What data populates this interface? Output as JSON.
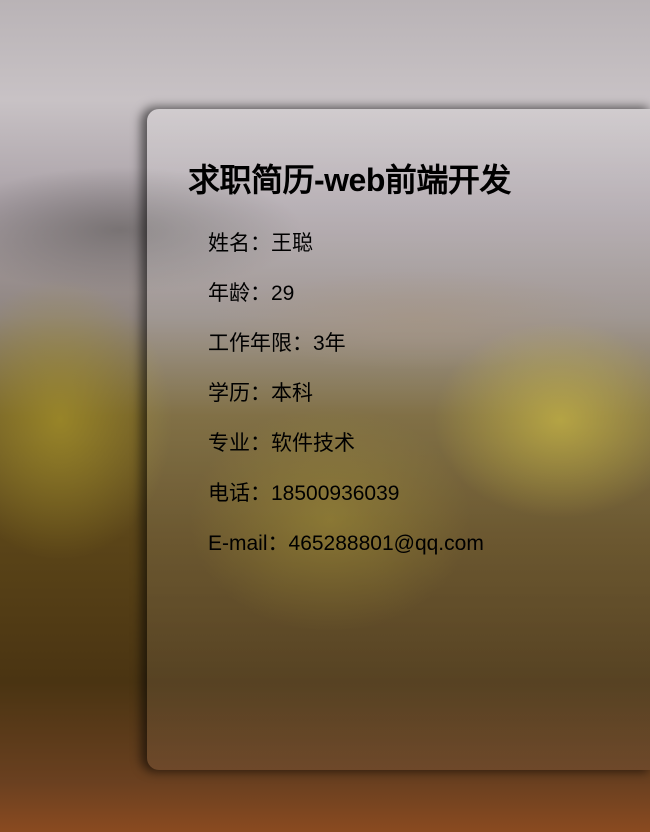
{
  "title": "求职简历-web前端开发",
  "items": [
    {
      "label": "姓名",
      "value": "王聪"
    },
    {
      "label": "年龄",
      "value": "29"
    },
    {
      "label": "工作年限",
      "value": "3年"
    },
    {
      "label": "学历",
      "value": "本科"
    },
    {
      "label": "专业",
      "value": "软件技术"
    },
    {
      "label": "电话",
      "value": "18500936039"
    },
    {
      "label": "E-mail",
      "value": "465288801@qq.com"
    }
  ],
  "separator": "："
}
